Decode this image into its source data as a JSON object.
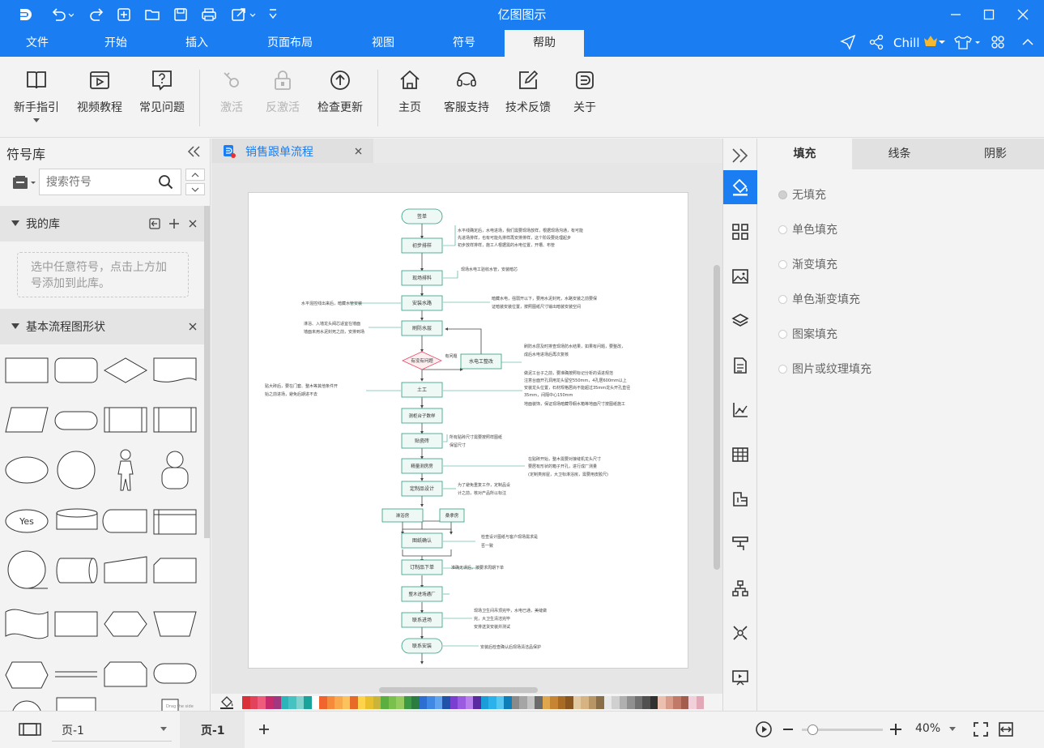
{
  "app": {
    "title": "亿图图示",
    "user": "Chill"
  },
  "menu": {
    "items": [
      {
        "label": "文件"
      },
      {
        "label": "开始"
      },
      {
        "label": "插入"
      },
      {
        "label": "页面布局"
      },
      {
        "label": "视图"
      },
      {
        "label": "符号"
      },
      {
        "label": "帮助"
      }
    ],
    "active": "帮助"
  },
  "ribbon": {
    "guide": "新手指引",
    "video": "视频教程",
    "faq": "常见问题",
    "activate": "激活",
    "deactivate": "反激活",
    "update": "检查更新",
    "home": "主页",
    "support": "客服支持",
    "feedback": "技术反馈",
    "about": "关于"
  },
  "library": {
    "title": "符号库",
    "search_placeholder": "搜索符号",
    "my_lib_title": "我的库",
    "my_lib_hint": "选中任意符号，点击上方加号添加到此库。",
    "basic_title": "基本流程图形状",
    "yes_label": "Yes",
    "drag_hint": "Drag the side"
  },
  "document": {
    "tab": "销售跟单流程"
  },
  "flowchart": {
    "nodes": {
      "n1": "签单",
      "n2": "初步排样",
      "n3": "现场排料",
      "n4": "安装水路",
      "n5": "刷防水层",
      "n6": "有没有问题",
      "n7": "水电工整改",
      "n8": "土工",
      "n9": "测柜台子数样",
      "n10": "贴瓷砖",
      "n11": "精量测房房",
      "n12": "定制品设计",
      "n13": "淋浴房",
      "n14": "桑拿房",
      "n15": "图纸确认",
      "n16": "订制品下单",
      "n17": "整木进场通厂",
      "n18": "联系进场",
      "n19": "联系安装"
    },
    "yes_edge": "有问题",
    "notes": {
      "a1": "水平线确定后，水电进场，我们需要现场放样，根据现场沟通，有可能",
      "a2": "先进场排样，也有可能先排样再安排排样，这个阶段要处理起步",
      "a3": "初步放样排样，施工人根据需的水电位置，开槽、布管",
      "b1": "现场水电工验收水管，安装暗芯",
      "c1": "暗藏水电，强弱开以下，要用水泥封死，水路安装之前要保",
      "c2": "证暗装安装位置，按照图纸尺寸输出暗装安装空间",
      "d1": "水平混控线出来后，暗藏水管安装",
      "e1": "淋浴、入墙龙头阀芯适宜在墙面",
      "e2": "墙面未用水泥封死之前，安排到场",
      "f1": "刷防水层及时排查现场防水结果，如果有问题，要整改，",
      "f2": "成后水电进场后再次复核",
      "g1": "做泥工台子之前，要准确按照标记分析的请进规范",
      "g2": "注意台面开孔洞用龙头留空550mm，4孔居600mm以上",
      "g3": "安装龙头位置，石材规格居尚不能超过35mm龙头开孔直径",
      "g4": "35mm，间隔中心150mm",
      "g5": "地面装饰，保证现场暗藏导橱水箱等地面尺寸按图纸施工",
      "h1": "贴大砖后，要在门套、整木等其他条件开",
      "h2": "始之前进场，避免后期进不去",
      "i1": "所有贴砖尺寸需要按照样图纸",
      "i2": "保留尺寸",
      "j1": "在贴砖开始，整木需要对接缝机龙头尺寸",
      "j2": "要居有形状的箱子开孔，进行成厂测量",
      "j3": "(定制类房屋，大卫标淋浴房，需要用皮胶尺)",
      "k1": "为了避免重复工作，定制品设",
      "k2": "计之前，核对产品所以标注",
      "l1": "检查设计图纸与客户现场需求是",
      "l2": "否一致",
      "m1": "准确无误后，按要求周期下单",
      "n1": "现场卫生间吊顶完毕，水电已通，美缝做",
      "n2": "完，大卫生清洁完毕",
      "n3": "安排送货安装并测试",
      "o1": "安装后检查确认后现场清洁品保护"
    }
  },
  "rightpanel": {
    "tabs": [
      "填充",
      "线条",
      "阴影"
    ],
    "options": [
      "无填充",
      "单色填充",
      "渐变填充",
      "单色渐变填充",
      "图案填充",
      "图片或纹理填充"
    ]
  },
  "status": {
    "page_select": "页-1",
    "page_tab": "页-1",
    "zoom": "40%"
  },
  "zoom_level": 0.07,
  "colors": {
    "accent": "#1a7ef2",
    "node_fill": "#eef8f4",
    "node_border": "#2e9e82",
    "decision": "#e84d6c"
  }
}
